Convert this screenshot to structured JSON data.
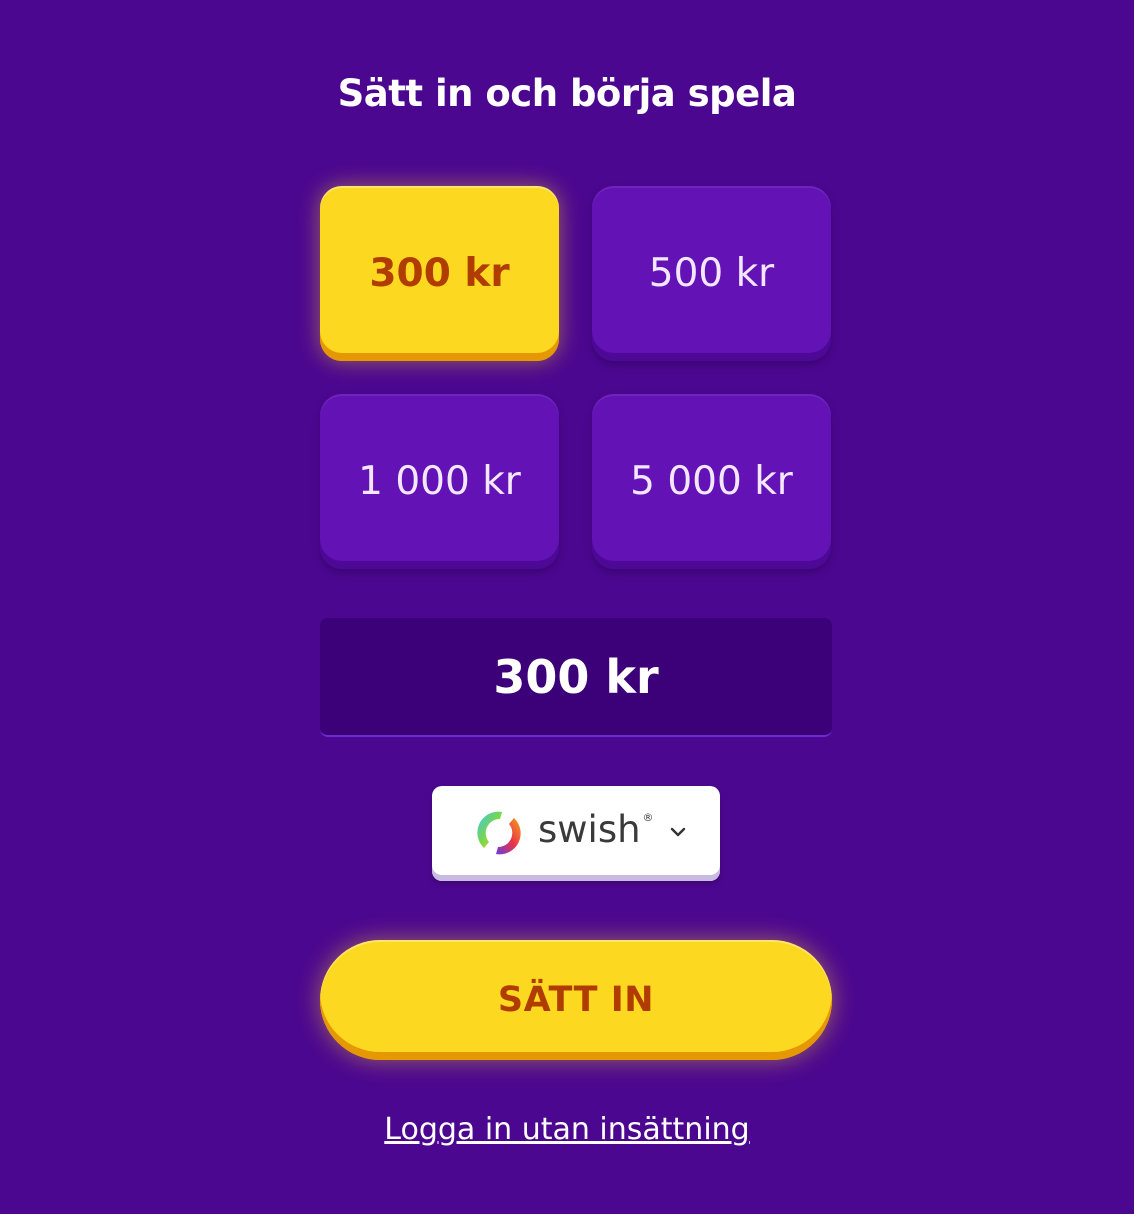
{
  "header": {
    "title": "Sätt in och börja spela"
  },
  "amounts": [
    {
      "label": "300 kr",
      "selected": true
    },
    {
      "label": "500 kr",
      "selected": false
    },
    {
      "label": "1 000 kr",
      "selected": false
    },
    {
      "label": "5 000 kr",
      "selected": false
    }
  ],
  "amount_field": {
    "value": "300 kr"
  },
  "payment": {
    "method": "swish",
    "registered_mark": "®"
  },
  "actions": {
    "deposit_label": "SÄTT IN",
    "login_link": "Logga in utan insättning"
  },
  "colors": {
    "background": "#4c0790",
    "accent_yellow": "#fdd820",
    "accent_text": "#b13c00",
    "button_purple": "#6312b5"
  }
}
